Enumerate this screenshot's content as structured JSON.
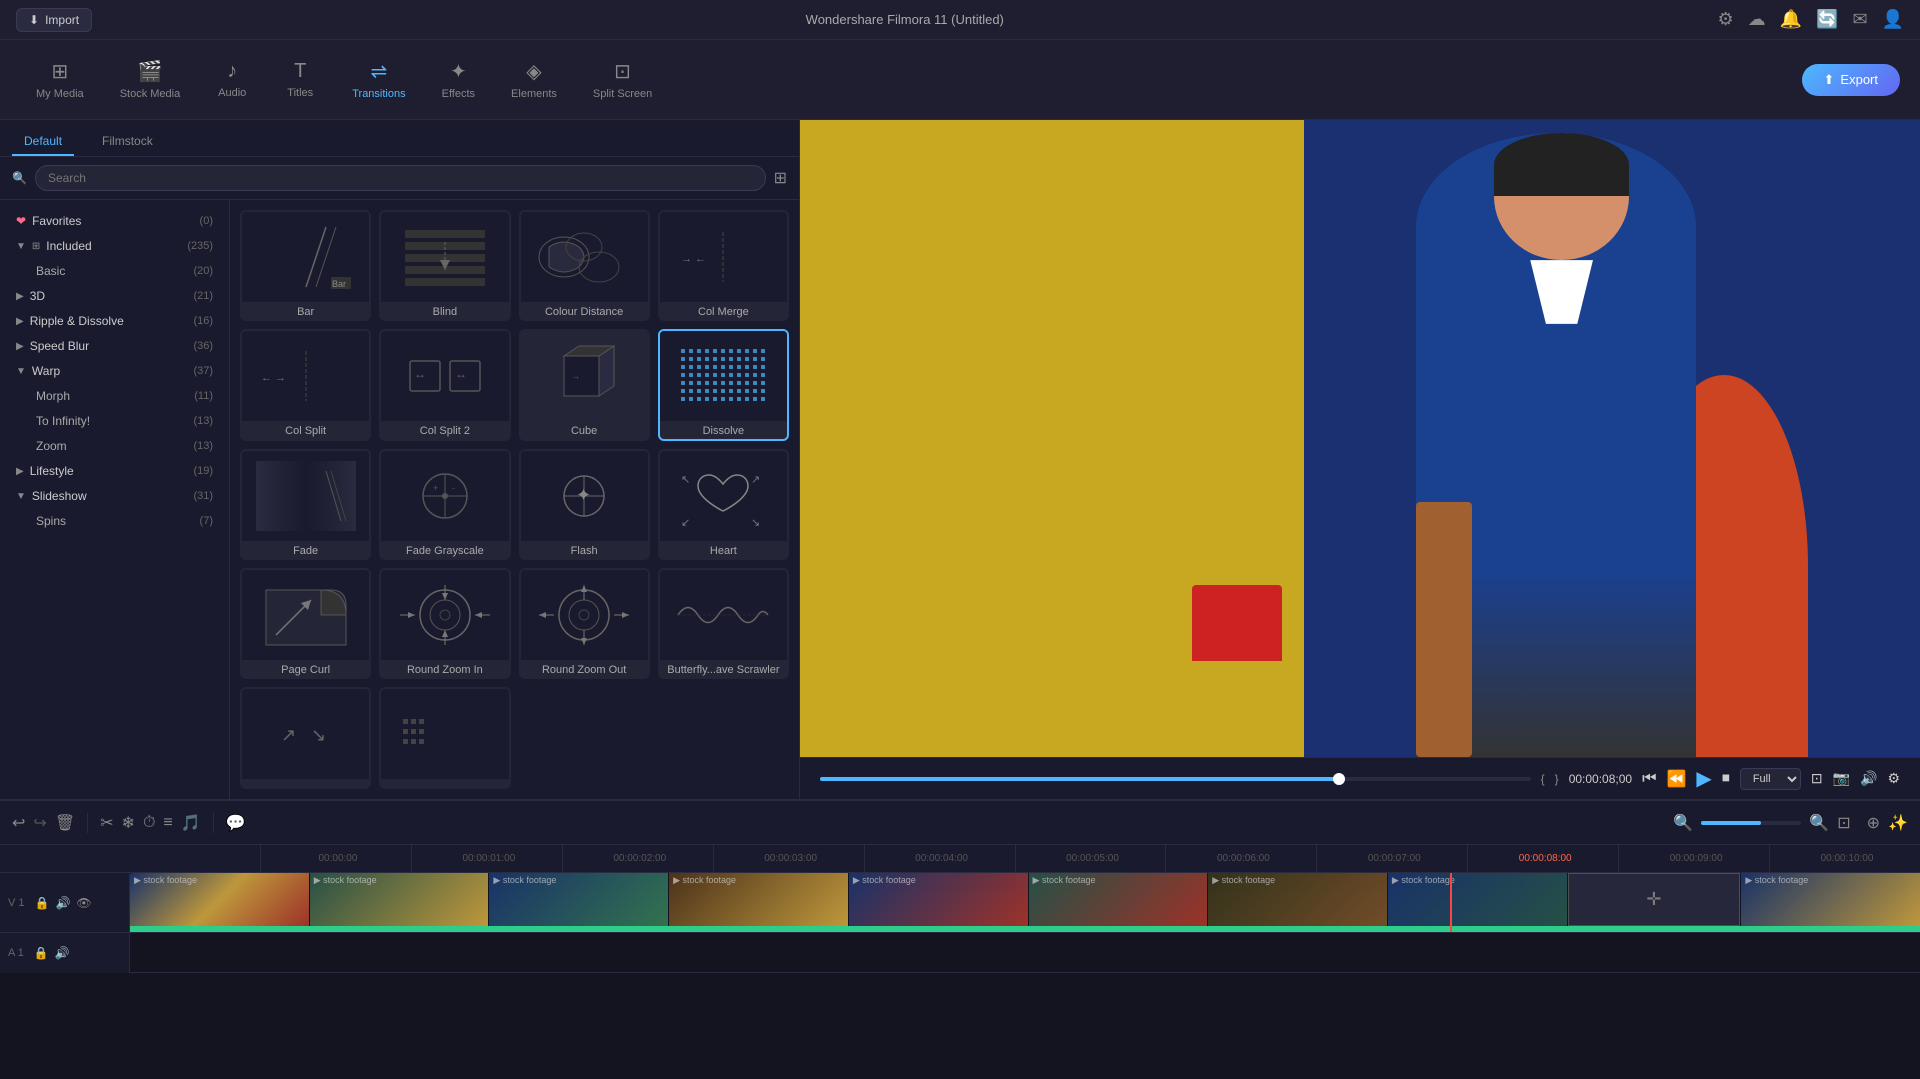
{
  "app": {
    "title": "Wondershare Filmora 11 (Untitled)"
  },
  "topbar": {
    "import_label": "Import",
    "icons": [
      "⚙",
      "☁",
      "🔔",
      "🔄",
      "✉",
      "👤"
    ]
  },
  "toolbar": {
    "items": [
      {
        "id": "my-media",
        "label": "My Media",
        "icon": "⊞"
      },
      {
        "id": "stock-media",
        "label": "Stock Media",
        "icon": "🎬"
      },
      {
        "id": "audio",
        "label": "Audio",
        "icon": "♪"
      },
      {
        "id": "titles",
        "label": "Titles",
        "icon": "T"
      },
      {
        "id": "transitions",
        "label": "Transitions",
        "icon": "⇌"
      },
      {
        "id": "effects",
        "label": "Effects",
        "icon": "✦"
      },
      {
        "id": "elements",
        "label": "Elements",
        "icon": "◈"
      },
      {
        "id": "split-screen",
        "label": "Split Screen",
        "icon": "⊡"
      }
    ],
    "export_label": "Export"
  },
  "panel": {
    "tabs": [
      {
        "id": "default",
        "label": "Default"
      },
      {
        "id": "filmstock",
        "label": "Filmstock"
      }
    ],
    "search_placeholder": "Search"
  },
  "sidebar": {
    "items": [
      {
        "id": "favorites",
        "label": "Favorites",
        "count": "(0)",
        "icon": "❤",
        "type": "favorites"
      },
      {
        "id": "included",
        "label": "Included",
        "count": "(235)",
        "icon": "⊞",
        "type": "group",
        "expanded": true
      },
      {
        "id": "basic",
        "label": "Basic",
        "count": "(20)",
        "type": "sub"
      },
      {
        "id": "3d",
        "label": "3D",
        "count": "(21)",
        "type": "group"
      },
      {
        "id": "ripple",
        "label": "Ripple & Dissolve",
        "count": "(16)",
        "type": "group"
      },
      {
        "id": "speed-blur",
        "label": "Speed Blur",
        "count": "(36)",
        "type": "group"
      },
      {
        "id": "warp",
        "label": "Warp",
        "count": "(37)",
        "type": "group",
        "expanded": true
      },
      {
        "id": "morph",
        "label": "Morph",
        "count": "(11)",
        "type": "sub"
      },
      {
        "id": "to-infinity",
        "label": "To Infinity!",
        "count": "(13)",
        "type": "sub"
      },
      {
        "id": "zoom",
        "label": "Zoom",
        "count": "(13)",
        "type": "sub"
      },
      {
        "id": "lifestyle",
        "label": "Lifestyle",
        "count": "(19)",
        "type": "group"
      },
      {
        "id": "slideshow",
        "label": "Slideshow",
        "count": "(31)",
        "type": "group",
        "expanded": true
      },
      {
        "id": "spins",
        "label": "Spins",
        "count": "(7)",
        "type": "sub"
      }
    ]
  },
  "transitions": {
    "items": [
      {
        "id": "bar",
        "name": "Bar"
      },
      {
        "id": "blind",
        "name": "Blind"
      },
      {
        "id": "colour-distance",
        "name": "Colour Distance"
      },
      {
        "id": "col-merge",
        "name": "Col Merge"
      },
      {
        "id": "col-split",
        "name": "Col Split"
      },
      {
        "id": "col-split-2",
        "name": "Col Split 2"
      },
      {
        "id": "cube",
        "name": "Cube"
      },
      {
        "id": "dissolve",
        "name": "Dissolve",
        "selected": true
      },
      {
        "id": "fade",
        "name": "Fade"
      },
      {
        "id": "fade-grayscale",
        "name": "Fade Grayscale"
      },
      {
        "id": "flash",
        "name": "Flash"
      },
      {
        "id": "heart",
        "name": "Heart"
      },
      {
        "id": "page-curl",
        "name": "Page Curl"
      },
      {
        "id": "round-zoom-in",
        "name": "Round Zoom In"
      },
      {
        "id": "round-zoom-out",
        "name": "Round Zoom Out"
      },
      {
        "id": "butterfly-scrawler",
        "name": "Butterfly...ave Scrawler"
      },
      {
        "id": "more1",
        "name": ""
      },
      {
        "id": "more2",
        "name": ""
      }
    ]
  },
  "playback": {
    "time_current": "00:00:08;00",
    "time_bracket_open": "{",
    "time_bracket_close": "}",
    "zoom_level": "Full"
  },
  "timeline": {
    "ruler_marks": [
      "00:00:00",
      "00:00:01:00",
      "00:00:02:00",
      "00:00:03:00",
      "00:00:04:00",
      "00:00:05:00",
      "00:00:06:00",
      "00:00:07:00",
      "00:00:08:00",
      "00:00:09:00",
      "00:00:10:00"
    ],
    "tracks": [
      {
        "type": "video",
        "num": "1",
        "label": "stock footage"
      },
      {
        "type": "audio",
        "num": "1",
        "label": ""
      }
    ]
  },
  "colors": {
    "accent": "#4db8ff",
    "bg_dark": "#1a1a2e",
    "bg_panel": "#1e1e30",
    "selected_border": "#4db8ff",
    "playhead": "#ff4444",
    "green": "#2dce89"
  }
}
